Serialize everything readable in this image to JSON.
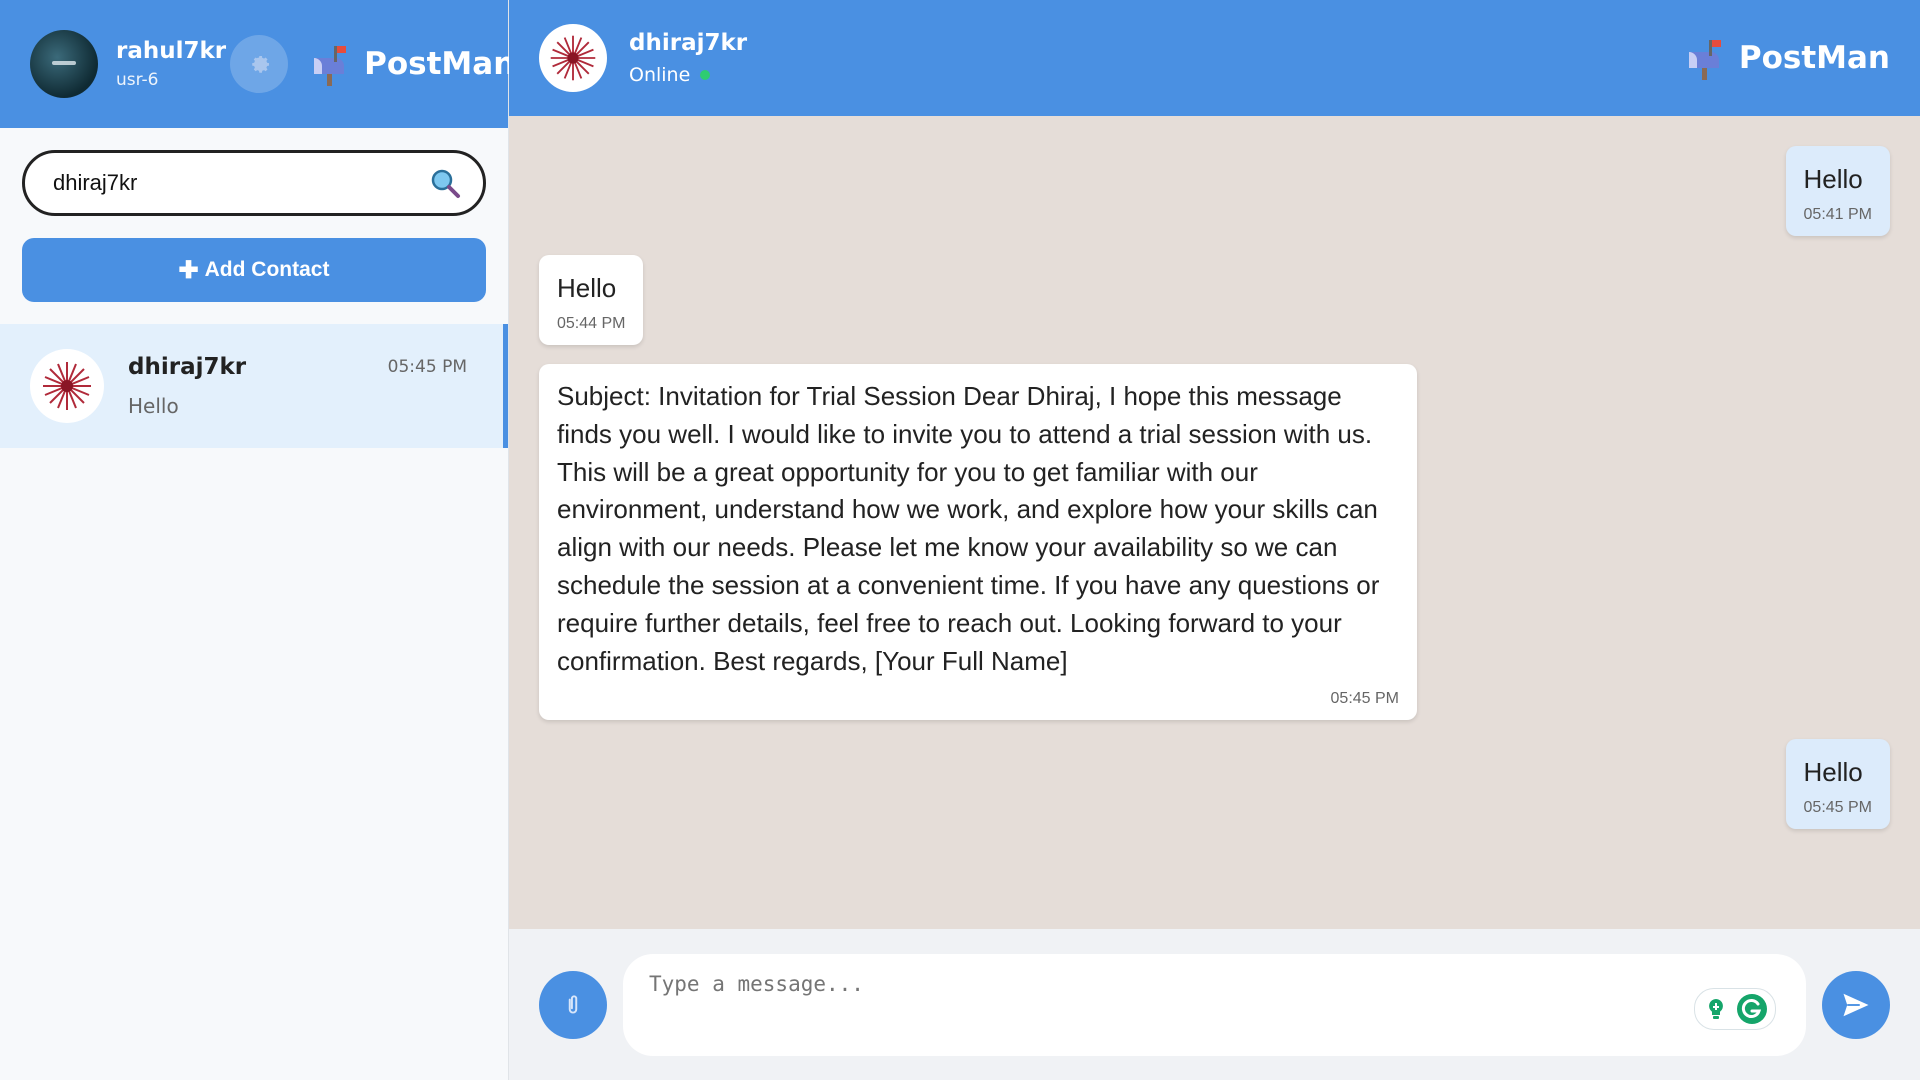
{
  "sidebar": {
    "user": {
      "name": "rahul7kr",
      "id": "usr-6"
    },
    "brand": "PostMan",
    "search": {
      "value": "dhiraj7kr"
    },
    "add_contact_label": "Add Contact",
    "contacts": [
      {
        "name": "dhiraj7kr",
        "time": "05:45 PM",
        "last_message": "Hello"
      }
    ]
  },
  "chat": {
    "peer": {
      "name": "dhiraj7kr",
      "status": "Online"
    },
    "brand": "PostMan",
    "messages": [
      {
        "direction": "out",
        "text": "Hello",
        "time": "05:41 PM"
      },
      {
        "direction": "in",
        "text": "Hello",
        "time": "05:44 PM"
      },
      {
        "direction": "in",
        "text": "Subject: Invitation for Trial Session Dear Dhiraj, I hope this message finds you well. I would like to invite you to attend a trial session with us. This will be a great opportunity for you to get familiar with our environment, understand how we work, and explore how your skills can align with our needs. Please let me know your availability so we can schedule the session at a convenient time. If you have any questions or require further details, feel free to reach out. Looking forward to your confirmation. Best regards, [Your Full Name]",
        "time": "05:45 PM"
      },
      {
        "direction": "out",
        "text": "Hello",
        "time": "05:45 PM"
      }
    ],
    "composer": {
      "placeholder": "Type a message..."
    }
  },
  "colors": {
    "primary": "#4a90e2",
    "chat_bg": "#e5ddd8",
    "outgoing_bubble": "#dcebfb",
    "incoming_bubble": "#ffffff",
    "online": "#2ecc71",
    "selected_contact": "#e3f0fc"
  },
  "icons": {
    "settings": "gear-icon",
    "brand": "mailbox-icon",
    "search": "search-icon",
    "add": "plus-icon",
    "attach": "paperclip-icon",
    "send": "send-icon",
    "extensions": [
      "grammar-assistant-icon",
      "grammarly-icon"
    ]
  }
}
